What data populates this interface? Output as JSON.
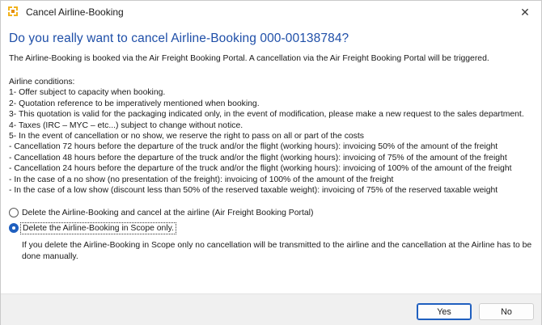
{
  "window": {
    "title": "Cancel Airline-Booking",
    "close_glyph": "✕",
    "icon": "app-icon",
    "accent_color": "#1f4fa8"
  },
  "dialog": {
    "heading": "Do you really want to cancel Airline-Booking 000-00138784?",
    "intro": "The Airline-Booking is booked via the Air Freight Booking Portal. A cancellation via the Air Freight Booking Portal will be triggered.",
    "conditions": [
      "Airline conditions:",
      "1- Offer subject to capacity when booking.",
      "2- Quotation reference to be imperatively mentioned when booking.",
      "3- This quotation is valid for the packaging indicated only, in the event of modification, please make a new request to the sales department.",
      "4- Taxes (IRC – MYC – etc...) subject to change without notice.",
      "5- In the event of cancellation or no show, we reserve the right to pass on all or part of the costs",
      "- Cancellation 72 hours before the departure of the truck and/or the flight (working hours): invoicing 50% of the amount of the freight",
      "- Cancellation 48 hours before the departure of the truck and/or the flight (working hours): invoicing of 75% of the amount of the freight",
      "- Cancellation 24 hours before the departure of the truck and/or the flight (working hours): invoicing of 100% of the amount of the freight",
      "- In the case of a no show (no presentation of the freight): invoicing of 100% of the amount of the freight",
      "- In the case of a low show (discount less than 50% of the reserved taxable weight): invoicing of 75% of the reserved taxable weight"
    ],
    "options": [
      {
        "label": "Delete the Airline-Booking and cancel at the airline (Air Freight Booking Portal)",
        "checked": false
      },
      {
        "label": "Delete the Airline-Booking in Scope only.",
        "checked": true
      }
    ],
    "note": "If you delete the Airline-Booking in Scope only no cancellation will be transmitted to the airline and the cancellation at the Airline has to be done manually."
  },
  "buttons": {
    "yes": "Yes",
    "no": "No"
  }
}
